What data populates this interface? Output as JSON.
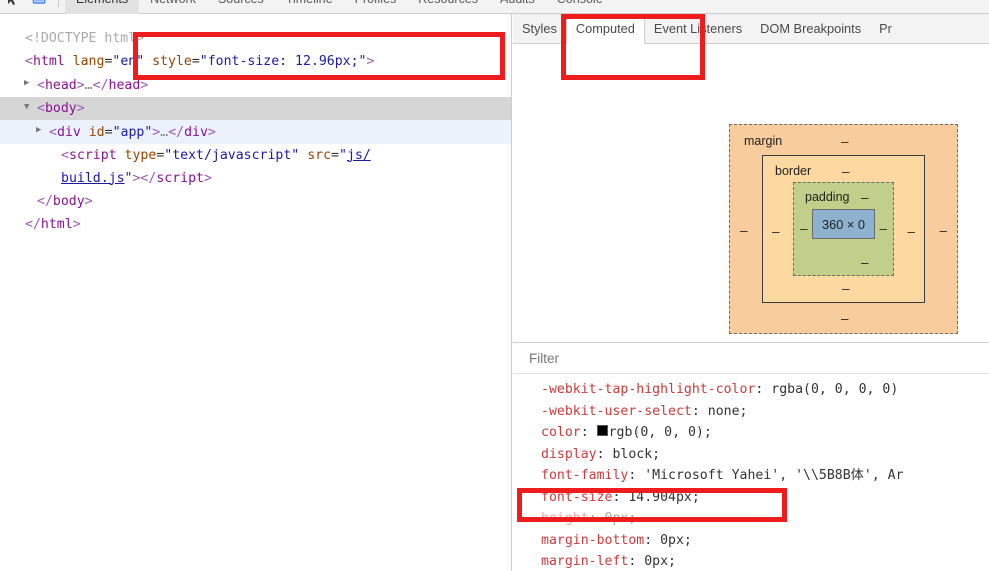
{
  "toolbar": {
    "icons": [
      {
        "name": "inspect-element-icon",
        "glyph": "↖"
      },
      {
        "name": "device-toolbar-icon",
        "glyph": "▭"
      }
    ],
    "tabs": [
      {
        "label": "Elements",
        "active": true
      },
      {
        "label": "Network",
        "active": false
      },
      {
        "label": "Sources",
        "active": false
      },
      {
        "label": "Timeline",
        "active": false
      },
      {
        "label": "Profiles",
        "active": false
      },
      {
        "label": "Resources",
        "active": false
      },
      {
        "label": "Audits",
        "active": false
      },
      {
        "label": "Console",
        "active": false
      }
    ]
  },
  "dom_tree": {
    "lines": [
      {
        "name": "doctype-line",
        "indent": 0,
        "twisty": "",
        "html": "<span class=\"tok-doctype\">&lt;!DOCTYPE html&gt;</span>",
        "highlight": ""
      },
      {
        "name": "html-element-line",
        "indent": 0,
        "twisty": "",
        "html": "<span class=\"tok-punct\">&lt;</span><span class=\"tok-tag\">html</span> <span class=\"tok-attr\">lang</span>=<span class=\"tok-val\">\"en\"</span> <span class=\"tok-attr\">style</span>=<span class=\"tok-val\">\"font-size: 12.96px;\"</span><span class=\"tok-punct\">&gt;</span>",
        "highlight": ""
      },
      {
        "name": "head-element-line",
        "indent": 1,
        "twisty": "▶",
        "html": "<span class=\"tok-punct\">&lt;</span><span class=\"tok-tag\">head</span><span class=\"tok-punct\">&gt;</span><span class=\"tok-ellipsis\">…</span><span class=\"tok-punct\">&lt;/</span><span class=\"tok-tag\">head</span><span class=\"tok-punct\">&gt;</span>",
        "highlight": ""
      },
      {
        "name": "body-element-line",
        "indent": 1,
        "twisty": "▼",
        "html": "<span class=\"tok-punct\">&lt;</span><span class=\"tok-tag\">body</span><span class=\"tok-punct\">&gt;</span>",
        "highlight": "sel-gray"
      },
      {
        "name": "div-app-element-line",
        "indent": 2,
        "twisty": "▶",
        "html": "<span class=\"tok-punct\">&lt;</span><span class=\"tok-tag\">div</span> <span class=\"tok-attr\">id</span>=<span class=\"tok-val\">\"app\"</span><span class=\"tok-punct\">&gt;</span><span class=\"tok-ellipsis\">…</span><span class=\"tok-punct\">&lt;/</span><span class=\"tok-tag\">div</span><span class=\"tok-punct\">&gt;</span>",
        "highlight": "sel-blue"
      },
      {
        "name": "script-element-line",
        "indent": 3,
        "twisty": "",
        "html": "<span class=\"tok-punct\">&lt;</span><span class=\"tok-tag\">script</span> <span class=\"tok-attr\">type</span>=<span class=\"tok-val\">\"text/javascript\"</span> <span class=\"tok-attr\">src</span>=<span class=\"tok-val\">\"</span><span class=\"tok-link\">js/</span>",
        "highlight": ""
      },
      {
        "name": "script-element-line-continued",
        "indent": 3,
        "twisty": "",
        "html": "<span class=\"tok-link\">build.js</span><span class=\"tok-val\">\"</span><span class=\"tok-punct\">&gt;&lt;/</span><span class=\"tok-tag\">script</span><span class=\"tok-punct\">&gt;</span>",
        "highlight": ""
      },
      {
        "name": "body-close-line",
        "indent": 1,
        "twisty": "",
        "html": "<span class=\"tok-punct\">&lt;/</span><span class=\"tok-tag\">body</span><span class=\"tok-punct\">&gt;</span>",
        "highlight": ""
      },
      {
        "name": "html-close-line",
        "indent": 0,
        "twisty": "",
        "html": "<span class=\"tok-punct\">&lt;/</span><span class=\"tok-tag\">html</span><span class=\"tok-punct\">&gt;</span>",
        "highlight": ""
      }
    ]
  },
  "sidebar": {
    "tabs": [
      {
        "label": "Styles",
        "active": false
      },
      {
        "label": "Computed",
        "active": true
      },
      {
        "label": "Event Listeners",
        "active": false
      },
      {
        "label": "DOM Breakpoints",
        "active": false
      },
      {
        "label": "Pr",
        "active": false
      }
    ]
  },
  "box_model": {
    "margin_label": "margin",
    "border_label": "border",
    "padding_label": "padding",
    "content_size": "360 × 0",
    "margin_top": "–",
    "margin_right": "–",
    "margin_bottom": "–",
    "margin_left": "–",
    "border_top": "–",
    "border_right": "–",
    "border_bottom": "–",
    "border_left": "–",
    "padding_top": "–",
    "padding_right": "–",
    "padding_bottom": "–",
    "padding_left": "–",
    "colors": {
      "margin": "#f9cc9d",
      "border": "#fdd8a0",
      "padding": "#c0d08a",
      "content": "#8cb2d0"
    }
  },
  "filter": {
    "placeholder": "Filter",
    "value": ""
  },
  "computed_properties": [
    {
      "name": "-webkit-tap-highlight-color",
      "value": "rgba(0, 0, 0, 0)",
      "swatch": false,
      "dimmed": false,
      "clipped": true
    },
    {
      "name": "-webkit-user-select",
      "value": "none;",
      "swatch": false,
      "dimmed": false,
      "clipped": false
    },
    {
      "name": "color",
      "value": "rgb(0, 0, 0);",
      "swatch": true,
      "swatch_color": "#000000",
      "dimmed": false,
      "clipped": false
    },
    {
      "name": "display",
      "value": "block;",
      "swatch": false,
      "dimmed": false,
      "clipped": false
    },
    {
      "name": "font-family",
      "value": "'Microsoft Yahei', '\\\\5B8B体', Ar",
      "swatch": false,
      "dimmed": false,
      "clipped": true
    },
    {
      "name": "font-size",
      "value": "14.904px;",
      "swatch": false,
      "dimmed": false,
      "clipped": false
    },
    {
      "name": "height",
      "value": "0px;",
      "swatch": false,
      "dimmed": true,
      "clipped": false
    },
    {
      "name": "margin-bottom",
      "value": "0px;",
      "swatch": false,
      "dimmed": false,
      "clipped": false
    },
    {
      "name": "margin-left",
      "value": "0px;",
      "swatch": false,
      "dimmed": false,
      "clipped": false
    }
  ],
  "annotations": {
    "color": "#ee1c1c",
    "boxes": [
      {
        "name": "annotation-html-style-attr"
      },
      {
        "name": "annotation-computed-tab"
      },
      {
        "name": "annotation-font-size-property"
      }
    ]
  }
}
